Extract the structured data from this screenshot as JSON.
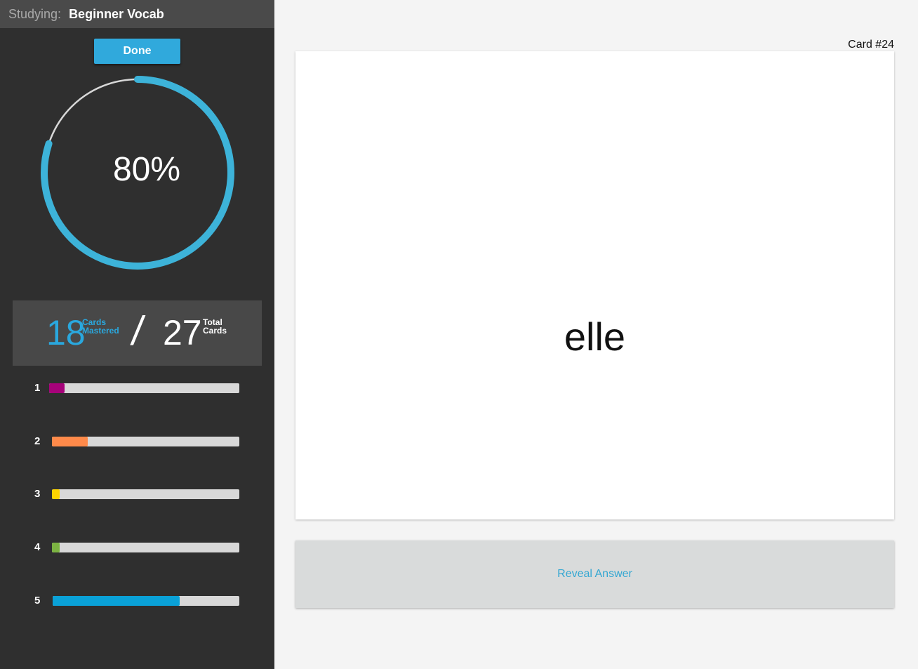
{
  "sidebar": {
    "studying_label": "Studying:",
    "deck_name": "Beginner Vocab",
    "done_label": "Done",
    "progress": {
      "percent": 80,
      "text": "80%"
    },
    "mastery": {
      "mastered_count": "18",
      "mastered_label_line1": "Cards",
      "mastered_label_line2": "Mastered",
      "separator": "/",
      "total_count": "27",
      "total_label_line1": "Total",
      "total_label_line2": "Cards"
    },
    "levels": [
      {
        "label": "1",
        "fill_fraction": 0.08,
        "color": "#a6027a"
      },
      {
        "label": "2",
        "fill_fraction": 0.19,
        "color": "#ff8a4a"
      },
      {
        "label": "3",
        "fill_fraction": 0.04,
        "color": "#ffd500"
      },
      {
        "label": "4",
        "fill_fraction": 0.04,
        "color": "#7cb342"
      },
      {
        "label": "5",
        "fill_fraction": 0.68,
        "color": "#0aa1d7"
      }
    ]
  },
  "card": {
    "number_text": "Card #24",
    "word": "elle"
  },
  "reveal_label": "Reveal Answer",
  "colors": {
    "accent": "#30a9dc",
    "ring_track": "#d8d8d8",
    "ring_fill": "#3db3d9"
  }
}
